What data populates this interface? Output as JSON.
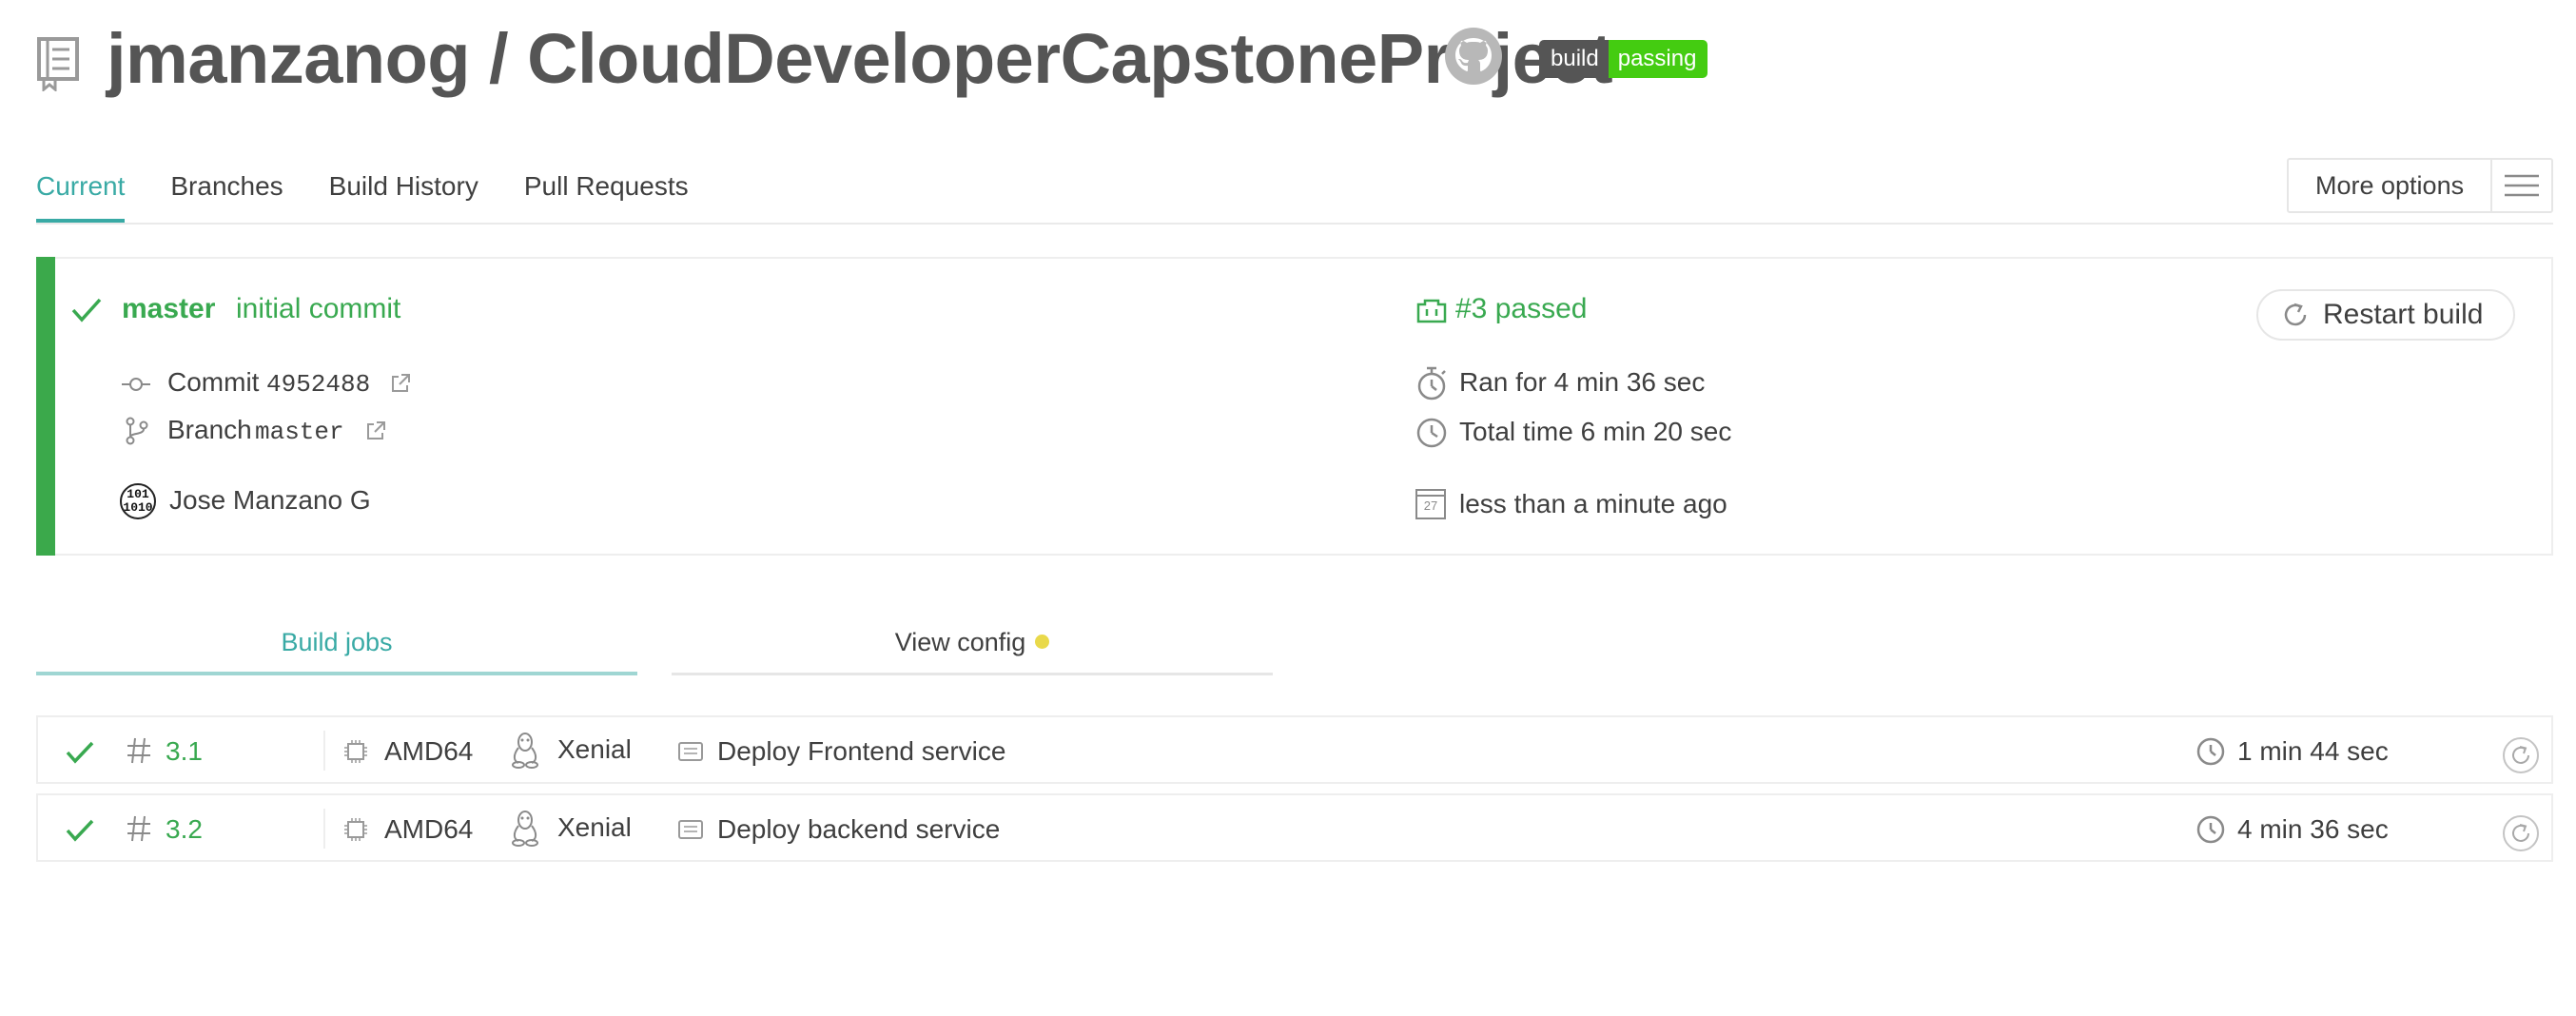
{
  "header": {
    "repo_owner": "jmanzanog",
    "repo_separator": "/",
    "repo_name": "CloudDeveloperCapstoneProject",
    "badge_left": "build",
    "badge_right": "passing"
  },
  "tabs": [
    {
      "label": "Current",
      "active": true
    },
    {
      "label": "Branches",
      "active": false
    },
    {
      "label": "Build History",
      "active": false
    },
    {
      "label": "Pull Requests",
      "active": false
    }
  ],
  "more_options_label": "More options",
  "build": {
    "branch": "master",
    "message": "initial commit",
    "number_status": "#3 passed",
    "commit_label": "Commit",
    "commit_hash": "4952488",
    "branch_label": "Branch",
    "branch_name": "master",
    "author": "Jose Manzano G",
    "avatar_text_top": "101",
    "avatar_text_bottom": "1010",
    "ran_for": "Ran for 4 min 36 sec",
    "total_time": "Total time 6 min 20 sec",
    "finished": "less than a minute ago",
    "calendar_day": "27",
    "restart_label": "Restart build"
  },
  "subtabs": {
    "build_jobs": "Build jobs",
    "view_config": "View config"
  },
  "jobs": [
    {
      "number": "3.1",
      "arch": "AMD64",
      "os": "Xenial",
      "name": "Deploy Frontend service",
      "duration": "1 min 44 sec"
    },
    {
      "number": "3.2",
      "arch": "AMD64",
      "os": "Xenial",
      "name": "Deploy backend service",
      "duration": "4 min 36 sec"
    }
  ],
  "colors": {
    "passed_green": "#39a950",
    "accent_teal": "#39aaa5",
    "badge_green": "#44cc11",
    "config_dot": "#e9d94a"
  },
  "icons": [
    "repo-icon",
    "github-icon",
    "hamburger-icon",
    "check-icon",
    "build-icon",
    "restart-icon",
    "commit-icon",
    "branch-icon",
    "external-link-icon",
    "stopwatch-icon",
    "clock-icon",
    "calendar-icon",
    "hash-icon",
    "cpu-icon",
    "linux-icon",
    "job-config-icon"
  ]
}
